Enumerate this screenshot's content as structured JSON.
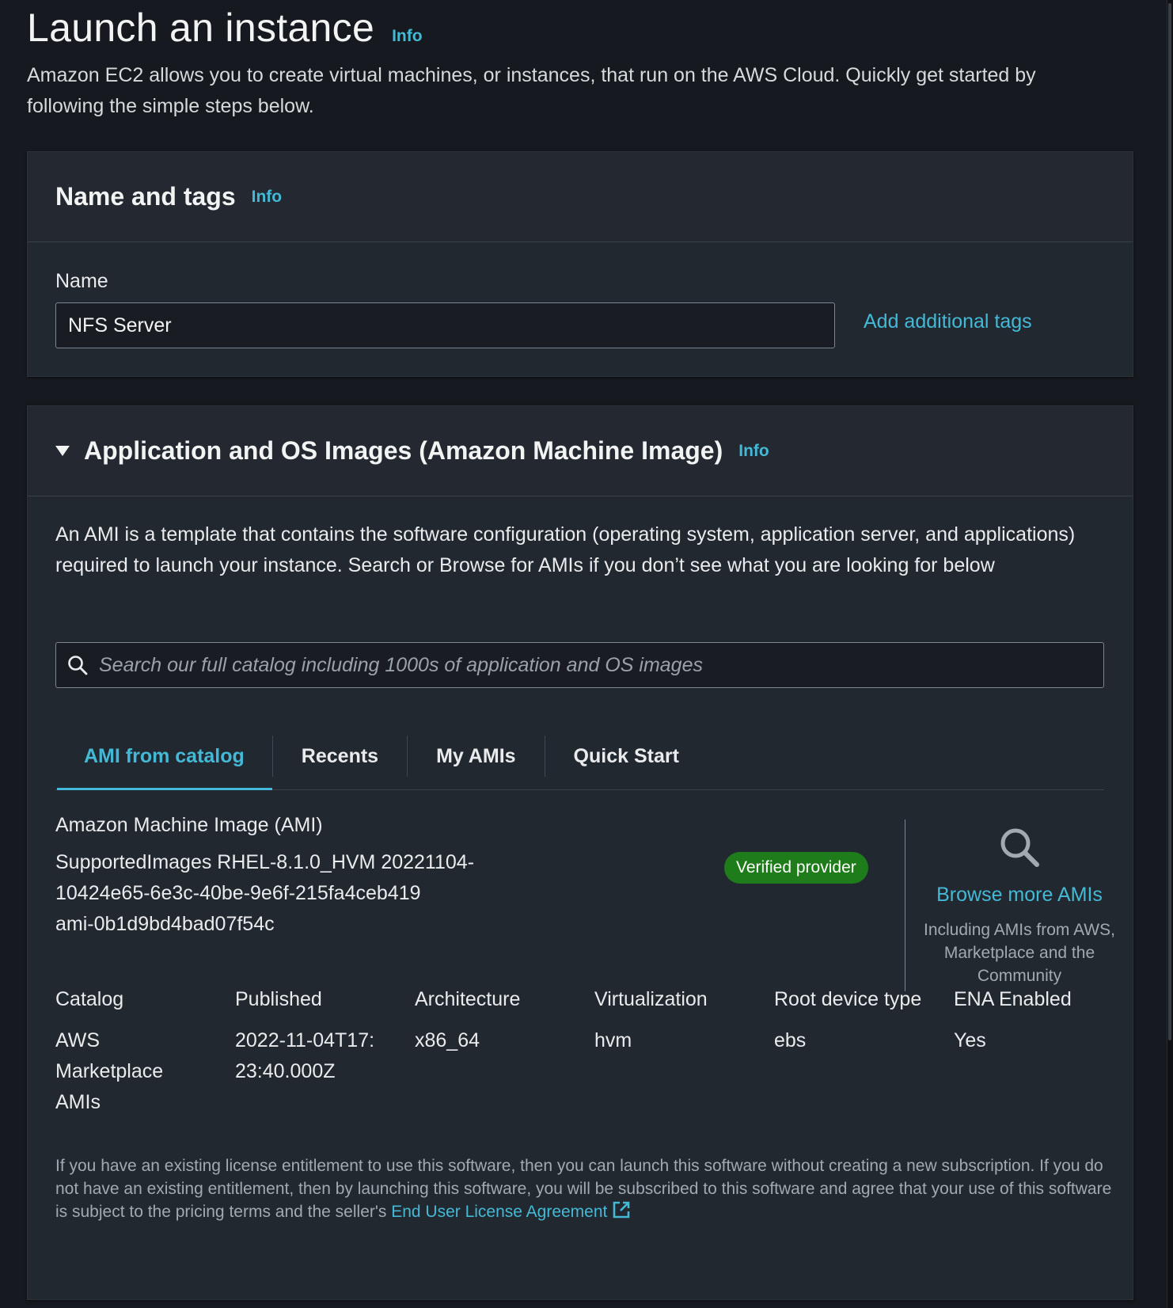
{
  "page": {
    "title": "Launch an instance",
    "info_label": "Info",
    "description": "Amazon EC2 allows you to create virtual machines, or instances, that run on the AWS Cloud. Quickly get started by following the simple steps below."
  },
  "name_tags": {
    "title": "Name and tags",
    "info_label": "Info",
    "name_label": "Name",
    "name_value": "NFS Server",
    "add_tags_label": "Add additional tags"
  },
  "ami": {
    "title": "Application and OS Images (Amazon Machine Image)",
    "info_label": "Info",
    "description": "An AMI is a template that contains the software configuration (operating system, application server, and applications) required to launch your instance. Search or Browse for AMIs if you don’t see what you are looking for below",
    "search_placeholder": "Search our full catalog including 1000s of application and OS images",
    "tabs": [
      {
        "label": "AMI from catalog",
        "active": true
      },
      {
        "label": "Recents",
        "active": false
      },
      {
        "label": "My AMIs",
        "active": false
      },
      {
        "label": "Quick Start",
        "active": false
      }
    ],
    "selected": {
      "heading": "Amazon Machine Image (AMI)",
      "name": "SupportedImages RHEL-8.1.0_HVM 20221104-10424e65-6e3c-40be-9e6f-215fa4ceb419",
      "id": "ami-0b1d9bd4bad07f54c",
      "badge": "Verified provider"
    },
    "browse": {
      "link": "Browse more AMIs",
      "subtext": "Including AMIs from AWS, Marketplace and the Community"
    },
    "attributes": [
      {
        "label": "Catalog",
        "value": "AWS Marketplace AMIs"
      },
      {
        "label": "Published",
        "value": "2022-11-04T17:23:40.000Z"
      },
      {
        "label": "Architecture",
        "value": "x86_64"
      },
      {
        "label": "Virtualization",
        "value": "hvm"
      },
      {
        "label": "Root device type",
        "value": "ebs"
      },
      {
        "label": "ENA Enabled",
        "value": "Yes"
      }
    ],
    "license_text": "If you have an existing license entitlement to use this software, then you can launch this software without creating a new subscription. If you do not have an existing entitlement, then by launching this software, you will be subscribed to this software and agree that your use of this software is subject to the pricing terms and the seller's",
    "eula_label": "End User License Agreement"
  },
  "colors": {
    "background": "#16191f",
    "link": "#44b9d6",
    "badge": "#1e7d1a"
  },
  "icons": {
    "search": "search-icon",
    "browse": "search-icon",
    "external": "external-link-icon",
    "caret": "caret-down-icon"
  }
}
